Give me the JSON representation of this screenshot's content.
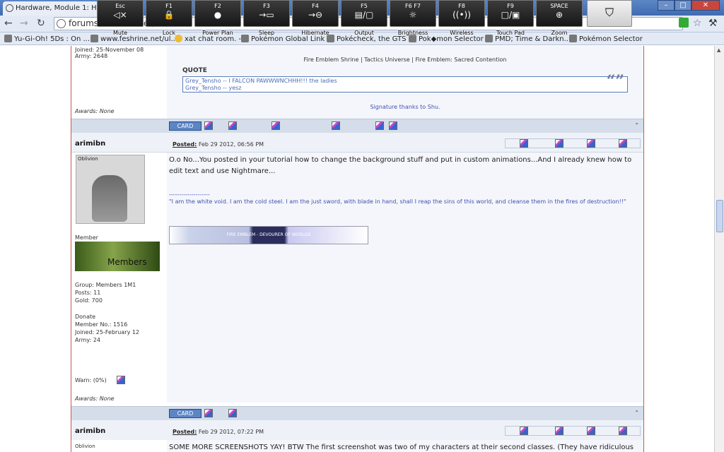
{
  "browser": {
    "tab_title": "Hardware, Module 1: Har",
    "url": "forums.feshrine.net/...",
    "window_buttons": [
      "–",
      "□",
      "✕"
    ],
    "bookmarks": [
      "Yu-Gi-Oh! 5Ds : On ...",
      "www.feshrine.net/ul...",
      "xat chat room. -",
      "Pokémon Global Link",
      "Pokécheck, the GTS ...",
      "Pok◆mon Selector",
      "PMD; Time & Darkn...",
      "Pokémon Selector"
    ]
  },
  "osd": {
    "keys": [
      {
        "key": "Esc",
        "glyph": "◁×",
        "label": "Mute"
      },
      {
        "key": "F1",
        "glyph": "🔒",
        "label": "Lock"
      },
      {
        "key": "F2",
        "glyph": "●",
        "label": "Power Plan"
      },
      {
        "key": "F3",
        "glyph": "→▭",
        "label": "Sleep"
      },
      {
        "key": "F4",
        "glyph": "→⊖",
        "label": "Hibernate"
      },
      {
        "key": "F5",
        "glyph": "▤/▢",
        "label": "Output"
      },
      {
        "key": "F6   F7",
        "glyph": "☼",
        "label": "Brightness"
      },
      {
        "key": "F8",
        "glyph": "((•))",
        "label": "Wireless"
      },
      {
        "key": "F9",
        "glyph": "□/▣",
        "label": "Touch Pad"
      },
      {
        "key": "SPACE",
        "glyph": "⊕",
        "label": "Zoom"
      }
    ],
    "lock_glyph": "⛉"
  },
  "post0": {
    "joined": "Joined: 25-November 08",
    "army": "Army: 2648",
    "awards": "Awards: None",
    "links": "Fire Emblem Shrine | Tactics Universe | Fire Emblem: Sacred Contention",
    "quote_label": "QUOTE",
    "quote_line1": "Grey_Tensho -- I FALCON PAWWWNCHHH!!! the ladies",
    "quote_line2": "Grey_Tensho -- yesz",
    "quote_mark": "“”",
    "sig_credit": "Signature thanks to Shu.",
    "card": "CARD"
  },
  "post1": {
    "username": "arimibn",
    "avatar_tag": "Oblivion",
    "posted_label": "Posted:",
    "posted_date": "Feb 29 2012, 06:56 PM",
    "rank": "Member",
    "banner_text": "Members",
    "group": "Group: Members 1M1",
    "posts": "Posts: 11",
    "gold": "Gold: 700",
    "donate": "Donate",
    "member_no": "Member No.: 1516",
    "joined": "Joined: 25-February 12",
    "army": "Army: 24",
    "warn": "Warn: (0%)",
    "awards": "Awards: None",
    "body": "O.o No...You posted in your tutorial how to change the background stuff and put in custom animations...And I already knew how to edit text and use Nightmare...",
    "divider": "--------------------",
    "signature": "\"I am the white void. I am the cold steel. I am the just sword, with blade in hand, shall I reap the sins of this world, and cleanse them in the fires of destruction!!\"",
    "sig_banner": "FIRE EMBLEM - DEVOURER OF WORLDS",
    "card": "CARD"
  },
  "post2": {
    "username": "arimibn",
    "avatar_tag": "Oblivion",
    "posted_label": "Posted:",
    "posted_date": "Feb 29 2012, 07:22 PM",
    "body": "SOME MORE SCREENSHOTS YAY! BTW The first screenshot was two of my characters at their second classes. (They have ridiculous"
  },
  "colors": {
    "accent": "#5c85c5",
    "frame": "#cc5555",
    "bar": "#d4dde9"
  }
}
